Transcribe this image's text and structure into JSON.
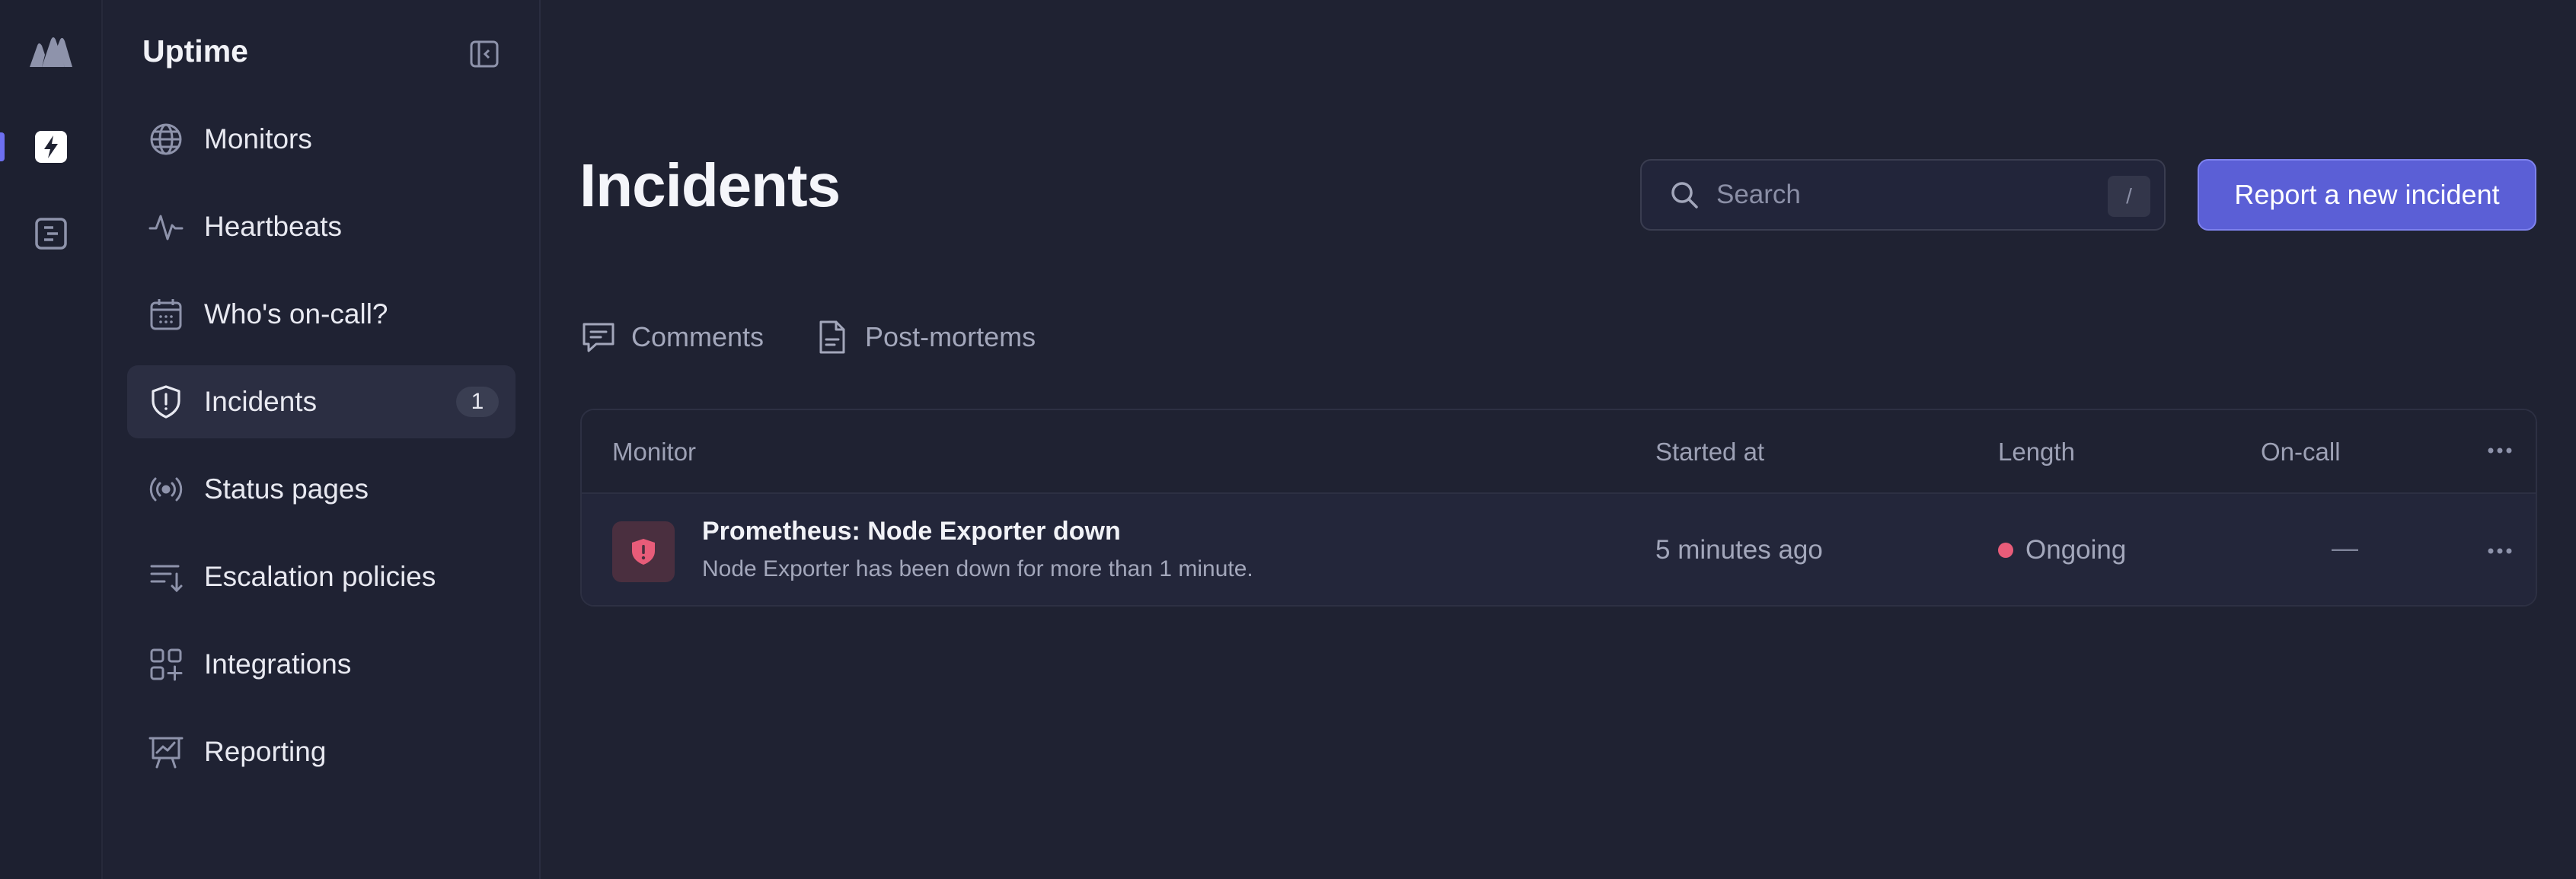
{
  "sidebar": {
    "title": "Uptime",
    "items": [
      {
        "label": "Monitors",
        "icon": "globe-icon"
      },
      {
        "label": "Heartbeats",
        "icon": "heartbeat-icon"
      },
      {
        "label": "Who's on-call?",
        "icon": "calendar-icon"
      },
      {
        "label": "Incidents",
        "icon": "shield-icon",
        "badge": "1",
        "active": true
      },
      {
        "label": "Status pages",
        "icon": "broadcast-icon"
      },
      {
        "label": "Escalation policies",
        "icon": "escalation-icon"
      },
      {
        "label": "Integrations",
        "icon": "integrations-icon"
      },
      {
        "label": "Reporting",
        "icon": "chart-board-icon"
      }
    ]
  },
  "main": {
    "title": "Incidents",
    "search": {
      "placeholder": "Search",
      "shortcut": "/"
    },
    "report_button": "Report a new incident",
    "tabs": [
      {
        "label": "Comments",
        "icon": "comment-icon"
      },
      {
        "label": "Post-mortems",
        "icon": "document-icon"
      }
    ],
    "table": {
      "headers": {
        "monitor": "Monitor",
        "started": "Started at",
        "length": "Length",
        "oncall": "On-call"
      },
      "rows": [
        {
          "title": "Prometheus: Node Exporter down",
          "subtitle": "Node Exporter has been down for more than 1 minute.",
          "started": "5 minutes ago",
          "length": "Ongoing",
          "oncall": "—"
        }
      ]
    }
  },
  "colors": {
    "accent": "#5b5fd6",
    "background": "#1f2232",
    "ongoing": "#e85c79"
  }
}
